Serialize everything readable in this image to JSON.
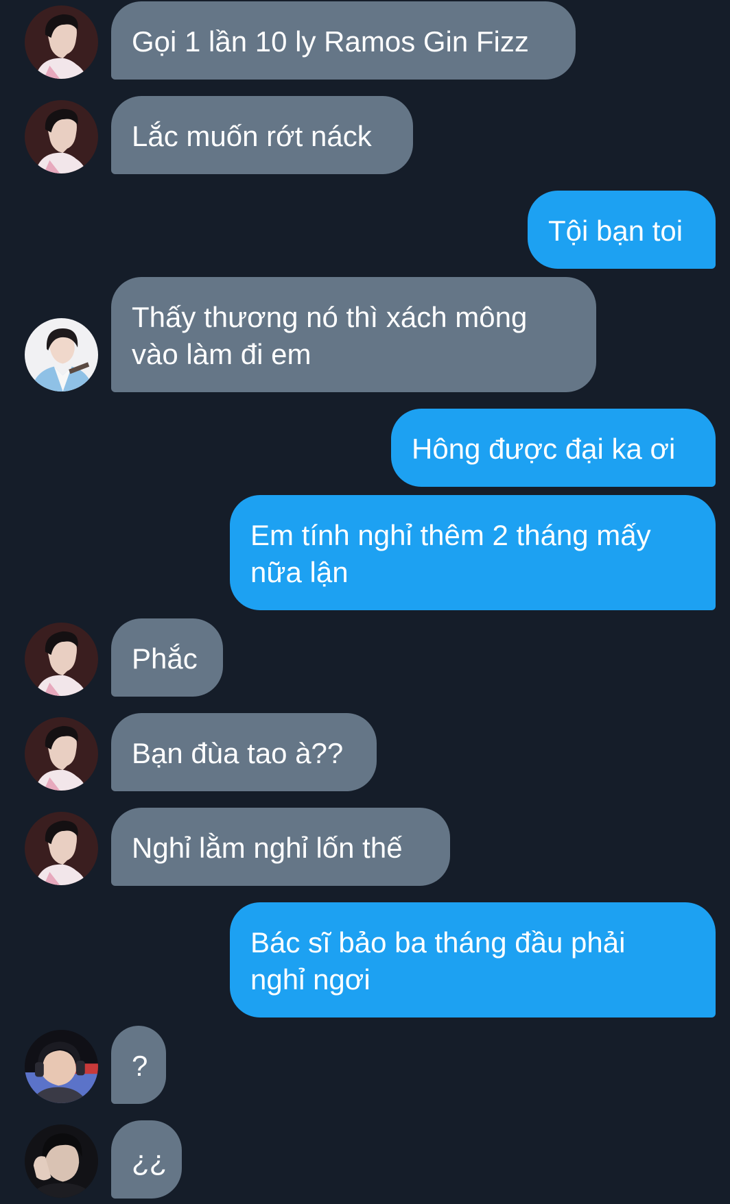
{
  "colors": {
    "background": "#151d29",
    "incoming_bubble": "#657687",
    "outgoing_bubble": "#1da1f2",
    "text": "#ffffff"
  },
  "avatars": {
    "profile_a": "avatar-boy-side-profile-icon",
    "profile_b": "avatar-boy-hanbok-icon",
    "profile_c": "avatar-headphones-gamer-icon",
    "profile_d": "avatar-dark-hand-face-icon"
  },
  "messages": [
    {
      "direction": "incoming",
      "avatar": "profile_a",
      "lines": [
        "Gọi 1 lần 10 ly Ramos Gin Fizz"
      ]
    },
    {
      "direction": "incoming",
      "avatar": "profile_a",
      "lines": [
        "Lắc muốn rớt náck"
      ]
    },
    {
      "direction": "outgoing",
      "lines": [
        "Tội bạn toi"
      ]
    },
    {
      "direction": "incoming",
      "avatar": "profile_b",
      "lines": [
        "Thấy thương nó thì xách mông",
        "vào làm đi em"
      ]
    },
    {
      "direction": "outgoing",
      "lines": [
        "Hông được đại ka ơi"
      ]
    },
    {
      "direction": "outgoing",
      "lines": [
        "Em tính nghỉ thêm 2 tháng mấy",
        "nữa lận"
      ]
    },
    {
      "direction": "incoming",
      "avatar": "profile_a",
      "lines": [
        "Phắc"
      ]
    },
    {
      "direction": "incoming",
      "avatar": "profile_a",
      "lines": [
        "Bạn đùa tao à??"
      ]
    },
    {
      "direction": "incoming",
      "avatar": "profile_a",
      "lines": [
        "Nghỉ lằm nghỉ lốn thế"
      ]
    },
    {
      "direction": "outgoing",
      "lines": [
        "Bác sĩ bảo ba tháng đầu phải",
        "nghỉ ngơi"
      ]
    },
    {
      "direction": "incoming",
      "avatar": "profile_c",
      "lines": [
        "?"
      ]
    },
    {
      "direction": "incoming",
      "avatar": "profile_d",
      "lines": [
        "¿¿"
      ]
    }
  ]
}
